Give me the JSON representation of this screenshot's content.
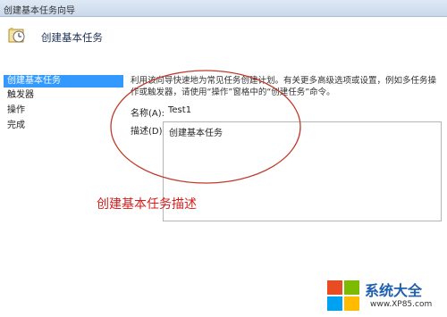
{
  "window": {
    "title": "创建基本任务向导"
  },
  "header": {
    "heading": "创建基本任务",
    "icon": "task-wizard-icon"
  },
  "sidebar": {
    "items": [
      {
        "label": "创建基本任务",
        "active": true
      },
      {
        "label": "触发器",
        "active": false
      },
      {
        "label": "操作",
        "active": false
      },
      {
        "label": "完成",
        "active": false
      }
    ]
  },
  "form": {
    "hint": "利用该向导快速地为常见任务创建计划。有关更多高级选项或设置，例如多任务操作或触发器，请使用“操作”窗格中的“创建任务”命令。",
    "name_label": "名称(A):",
    "name_value": "Test1",
    "desc_label": "描述(D):",
    "desc_value": "创建基本任务"
  },
  "annotation": {
    "text": "创建基本任务描述",
    "color": "#d41e1e"
  },
  "watermark": {
    "brand": "系统大全",
    "site": "www.XP85.com"
  }
}
